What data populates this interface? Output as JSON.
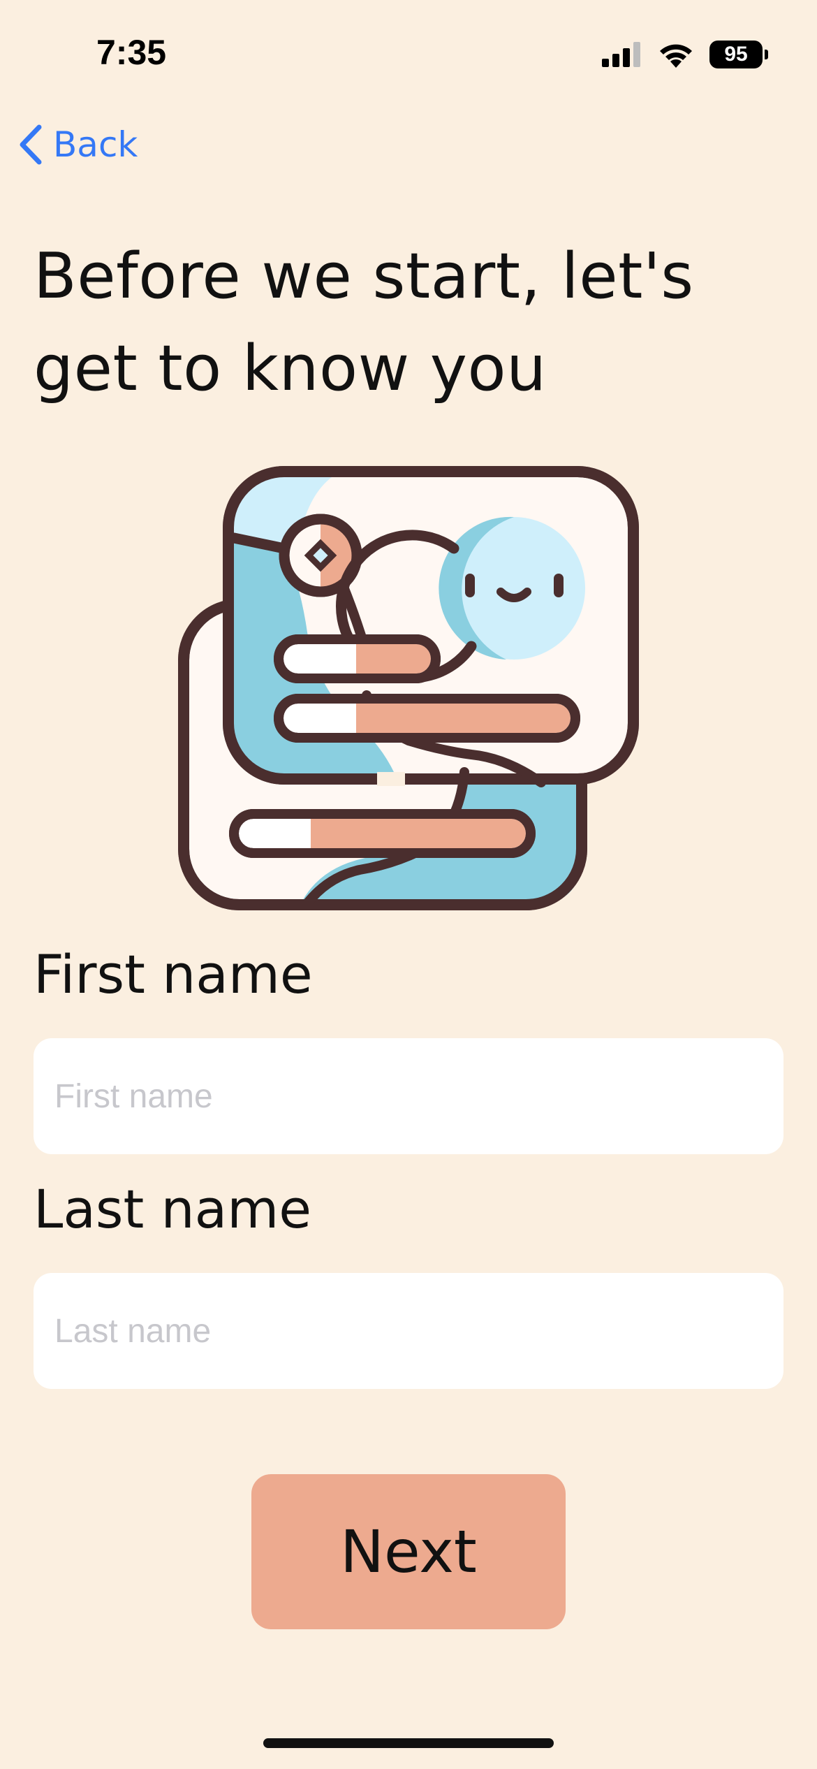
{
  "status_bar": {
    "time": "7:35",
    "battery_level": "95",
    "signal_icon": "cellular-signal-icon",
    "wifi_icon": "wifi-icon"
  },
  "nav": {
    "back_label": "Back",
    "back_icon": "chevron-left-icon"
  },
  "page": {
    "title": "Before we start, let's get to know you"
  },
  "illustration": {
    "icon": "profile-card-illustration"
  },
  "form": {
    "first_name": {
      "label": "First name",
      "placeholder": "First name",
      "value": ""
    },
    "last_name": {
      "label": "Last name",
      "placeholder": "Last name",
      "value": ""
    }
  },
  "actions": {
    "next_label": "Next"
  },
  "colors": {
    "background": "#FBEFE0",
    "accent": "#EDAA8F",
    "link": "#3478F6",
    "outline": "#4A2E2E",
    "blue_fill": "#8ACFE0",
    "light_blue": "#CFEFFB",
    "card_fill": "#FFF8F3"
  }
}
